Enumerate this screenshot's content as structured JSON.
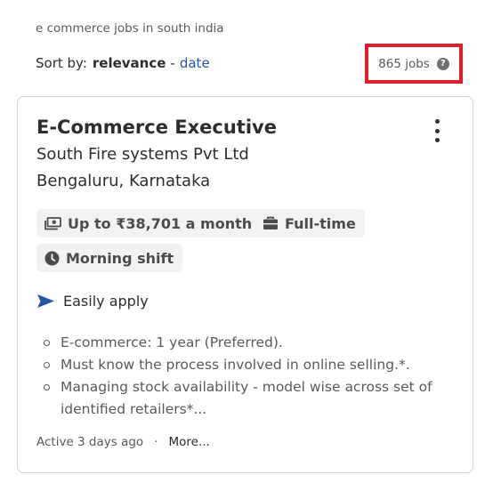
{
  "search": {
    "query_text": "e commerce jobs in south india"
  },
  "sort": {
    "label": "Sort by:",
    "active": "relevance",
    "separator": "-",
    "alternative": "date"
  },
  "results": {
    "count_text": "865 jobs",
    "help_glyph": "?",
    "highlight_color": "#e01e2b"
  },
  "job": {
    "title": "E-Commerce Executive",
    "company": "South Fire systems Pvt Ltd",
    "location": "Bengaluru, Karnataka",
    "tags": {
      "salary": "Up to ₹38,701 a month",
      "type": "Full-time",
      "shift": "Morning shift"
    },
    "apply_label": "Easily apply",
    "apply_icon_color": "#2557a7",
    "snippet": [
      "E-commerce: 1 year (Preferred).",
      "Must know the process involved in online selling.*.",
      "Managing stock availability - model wise across set of identified retailers*..."
    ],
    "footer": {
      "posted": "Active 3 days ago",
      "separator": "·",
      "more": "More..."
    }
  }
}
